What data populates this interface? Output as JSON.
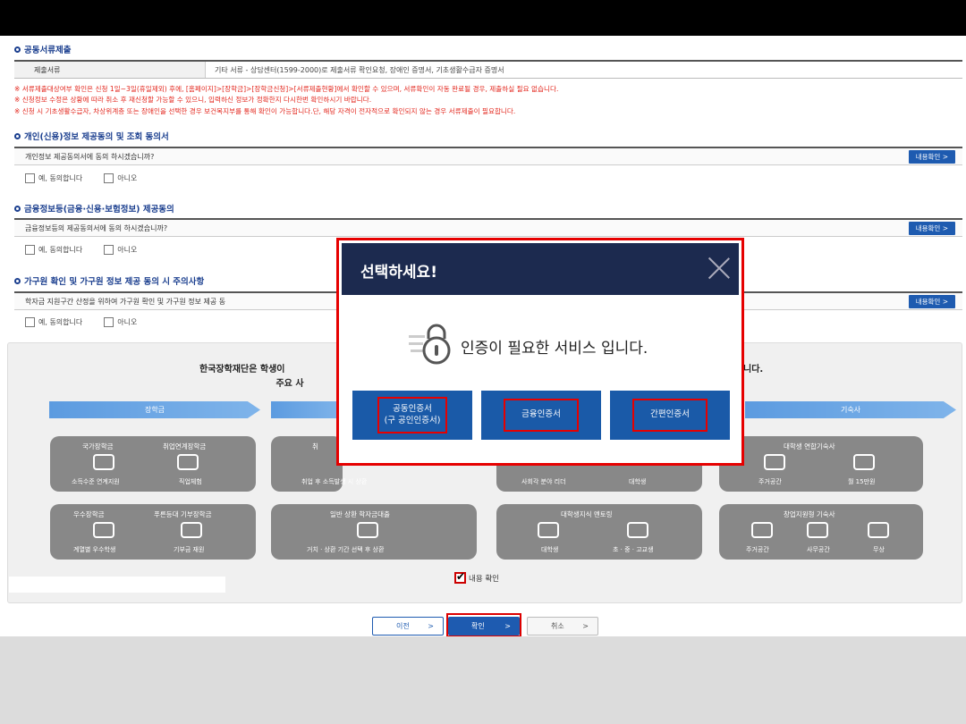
{
  "sections": {
    "documents": {
      "title": "공동서류제출",
      "label": "제출서류",
      "value": "기타 서류 - 상담센터(1599-2000)로 제출서류 확인요청, 장애인 증명서, 기초생활수급자 증명서"
    },
    "notices": [
      "※ 서류제출대상여부 확인은 신청 1일~3일(휴일제외) 후에, [홈페이지]>[장학금]>[장학금신청]>[서류제출현황]에서 확인할 수 있으며, 서류확인이 자동 완료될 경우, 제출하실 필요 없습니다.",
      "※ 신청정보 수정은 상황에 따라 취소 후 재신청할 가능할 수 있으니, 입력하신 정보가 정확한지 다시한번 확인하시기 바랍니다.",
      "※ 신청 시 기초생활수급자, 차상위계층 또는 장애인을 선택한 경우 보건복지부를 통해 확인이 가능합니다.단, 해당 자격이 전자적으로 확인되지 않는 경우 서류제출이 필요합니다."
    ],
    "personal_info": {
      "title": "개인(신용)정보 제공동의 및 조회 동의서",
      "question": "개인정보 제공동의서에 동의 하시겠습니까?",
      "view_btn": "내용확인 >",
      "yes": "예, 동의합니다",
      "no": "아니오"
    },
    "financial_info": {
      "title": "금융정보등(금융·신용·보험정보) 제공동의",
      "question": "금융정보등의 제공동의서에 동의 하시겠습니까?",
      "view_btn": "내용확인 >",
      "yes": "예, 동의합니다",
      "no": "아니오"
    },
    "household": {
      "title": "가구원 확인 및 가구원 정보 제공 동의 시 주의사항",
      "question": "학자금 지원구간 산정을 위하여 가구원 확인 및 가구원 정보 제공 동",
      "view_btn": "내용확인 >",
      "yes": "예, 동의합니다",
      "no": "아니오"
    }
  },
  "info_panel": {
    "title_left": "한국장학재단은 학생이",
    "title_right": "니다.",
    "title2": "주요 사",
    "banners": [
      "장학금",
      "기숙사"
    ],
    "cards": [
      {
        "l1": "국가장학금",
        "l2": "취업연계장학금",
        "s1": "소득수준 연계지원",
        "s2": "직업체험"
      },
      {
        "l1": "취",
        "s1": "취업 후 소득발생 시 상환"
      },
      {
        "s1": "사회각 분야 리더",
        "s2": "대학생"
      },
      {
        "l1": "대학생 연합기숙사",
        "s1": "주거공간",
        "s2": "월 15만원"
      },
      {
        "l1": "우수장학금",
        "l2": "푸른등대 기부장학금",
        "s1": "계열별 우수학생",
        "s2": "기부금 재원"
      },
      {
        "l1": "일반 상환 학자금대출",
        "s1": "거치 · 상환 기간 선택 후 상환"
      },
      {
        "l1": "대학생지식 멘토링",
        "s1": "대학생",
        "s2": "초 · 중 · 고교생"
      },
      {
        "l1": "창업지원형 기숙사",
        "s1": "주거공간",
        "s2": "사무공간",
        "s3": "무상"
      }
    ],
    "confirm_label": "내용 확인"
  },
  "buttons": {
    "prev": "이전",
    "ok": "확인",
    "cancel": "취소",
    "arrow": ">"
  },
  "modal": {
    "title": "선택하세요!",
    "message": "인증이 필요한 서비스 입니다.",
    "btn1_line1": "공동인증서",
    "btn1_line2": "(구 공인인증서)",
    "btn2": "금융인증서",
    "btn3": "간편인증서"
  },
  "colors": {
    "primary": "#1e5bb0",
    "header_dark": "#1c2a4f",
    "highlight": "#e60000",
    "notice": "#e3261c"
  }
}
